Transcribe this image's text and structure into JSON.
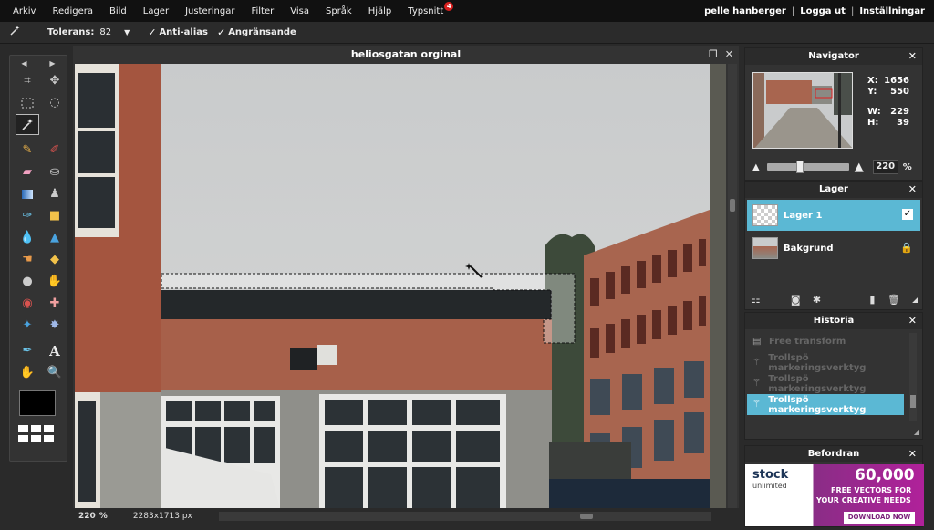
{
  "menu": {
    "items": [
      "Arkiv",
      "Redigera",
      "Bild",
      "Lager",
      "Justeringar",
      "Filter",
      "Visa",
      "Språk",
      "Hjälp",
      "Typsnitt"
    ],
    "typsnitt_badge": "4",
    "user": "pelle hanberger",
    "logout": "Logga ut",
    "settings": "Inställningar",
    "separator": "|"
  },
  "options": {
    "tolerance_label": "Tolerans:",
    "tolerance_value": "82",
    "antialias_label": "Anti-alias",
    "antialias_checked": true,
    "contiguous_label": "Angränsande",
    "contiguous_checked": true
  },
  "document": {
    "title": "heliosgatan orginal",
    "zoom": "220",
    "zoom_unit": "%",
    "dimensions": "2283x1713 px"
  },
  "toolbox": {
    "primary_color": "#000000"
  },
  "navigator": {
    "title": "Navigator",
    "x_label": "X:",
    "x_value": "1656",
    "y_label": "Y:",
    "y_value": "550",
    "w_label": "W:",
    "w_value": "229",
    "h_label": "H:",
    "h_value": "39",
    "zoom": "220",
    "zoom_unit": "%"
  },
  "layers": {
    "title": "Lager",
    "items": [
      {
        "name": "Lager 1",
        "selected": true
      },
      {
        "name": "Bakgrund",
        "selected": false
      }
    ]
  },
  "history": {
    "title": "Historia",
    "items": [
      {
        "label": "Free transform",
        "selected": false
      },
      {
        "label": "Trollspö markeringsverktyg",
        "selected": false
      },
      {
        "label": "Trollspö markeringsverktyg",
        "selected": false
      },
      {
        "label": "Trollspö markeringsverktyg",
        "selected": true
      }
    ]
  },
  "ad": {
    "title": "Befordran",
    "logo": "stock",
    "logo_sub": "unlimited",
    "amount": "60,000",
    "line1": "FREE VECTORS FOR",
    "line2": "YOUR CREATIVE NEEDS",
    "button": "DOWNLOAD NOW"
  },
  "colors": {
    "accent": "#5bb8d4",
    "badge": "#d8201f"
  }
}
